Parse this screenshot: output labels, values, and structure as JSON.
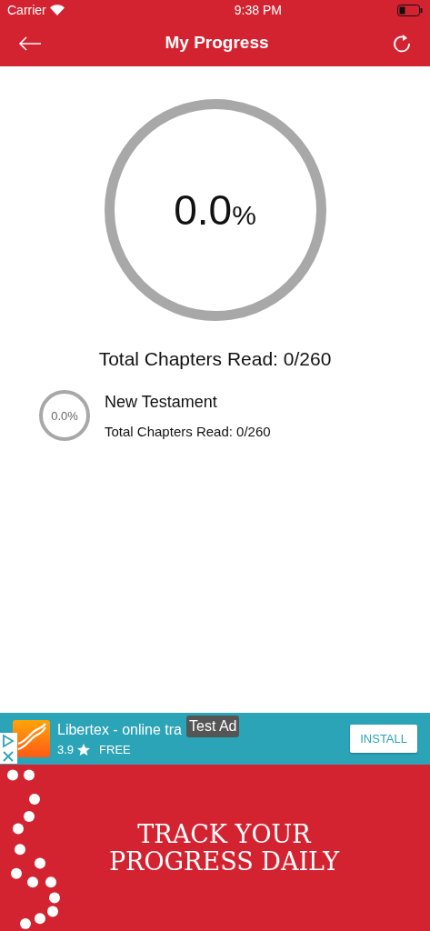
{
  "status_bar": {
    "carrier": "Carrier",
    "time": "9:38 PM"
  },
  "nav": {
    "title": "My Progress"
  },
  "overall": {
    "value": "0.0",
    "unit": "%",
    "caption": "Total Chapters Read: 0/260"
  },
  "books": [
    {
      "value": "0.0",
      "unit": "%",
      "title": "New Testament",
      "caption": "Total Chapters Read: 0/260"
    }
  ],
  "ad": {
    "title": "Libertex - online tra",
    "rating": "3.9",
    "price": "FREE",
    "button": "INSTALL",
    "overlay": "Test Ad"
  },
  "banner": {
    "lines": [
      "TRACK YOUR",
      "PROGRESS DAILY"
    ]
  }
}
